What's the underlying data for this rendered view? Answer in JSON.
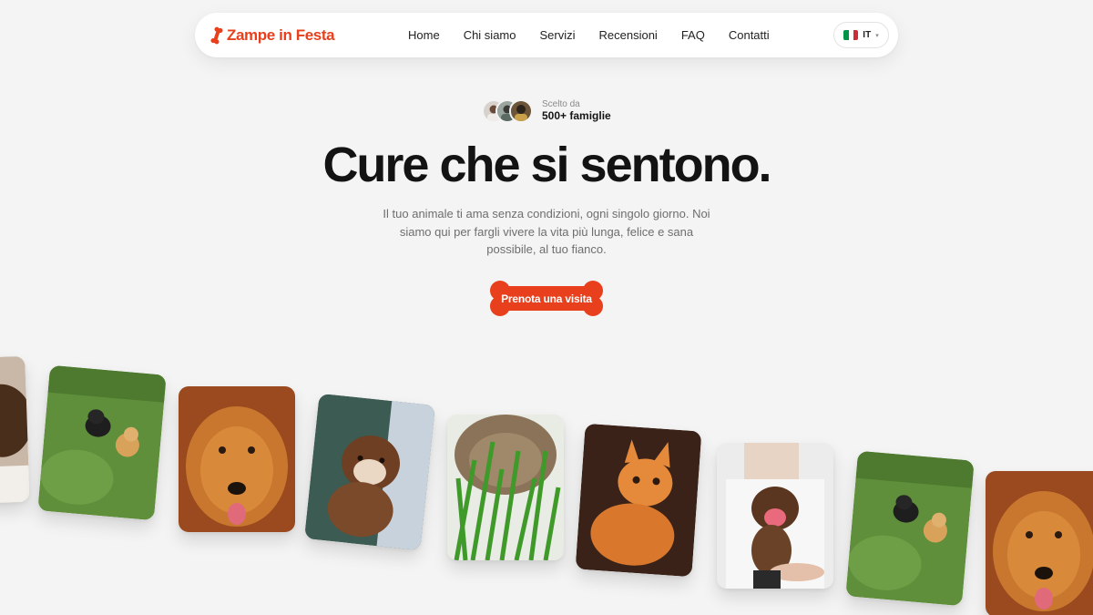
{
  "brand": {
    "name": "Zampe in Festa",
    "accent_color": "#e8401c"
  },
  "nav": {
    "links": [
      "Home",
      "Chi siamo",
      "Servizi",
      "Recensioni",
      "FAQ",
      "Contatti"
    ]
  },
  "language": {
    "code": "IT",
    "flag_icon": "italy-flag-icon",
    "flag_colors": [
      "#009246",
      "#ffffff",
      "#ce2b37"
    ]
  },
  "trust": {
    "label": "Scelto da",
    "count": "500+ famiglie",
    "avatar_count": 3
  },
  "hero": {
    "title": "Cure che si sentono.",
    "subtitle": "Il tuo animale ti ama senza condizioni, ogni singolo giorno. Noi siamo qui per fargli vivere la vita più lunga, felice e sana possibile, al tuo fianco."
  },
  "cta": {
    "label": "Prenota una visita",
    "icon": "bone-shape"
  },
  "gallery": {
    "photos": [
      "dog-photo-cropped",
      "puppies-on-grass-photo",
      "golden-retriever-photo",
      "puppy-held-photo",
      "cat-in-grass-photo",
      "orange-kitten-photo",
      "happy-puppy-held-photo",
      "puppies-on-grass-photo",
      "golden-retriever-photo"
    ]
  }
}
